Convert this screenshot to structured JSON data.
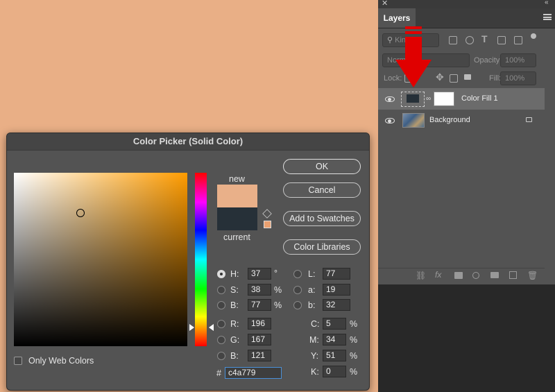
{
  "colors": {
    "new": "#e9b089",
    "current": "#263038",
    "accent_arrow": "#e00000"
  },
  "layers_panel": {
    "tab_label": "Layers",
    "filter_placeholder": "Kind",
    "blend_mode": "Normal",
    "opacity_label": "Opacity:",
    "opacity_value": "100%",
    "lock_label": "Lock:",
    "fill_label": "Fill:",
    "fill_value": "100%",
    "layers": [
      {
        "name": "Color Fill 1"
      },
      {
        "name": "Background"
      }
    ]
  },
  "dialog": {
    "title": "Color Picker (Solid Color)",
    "new_label": "new",
    "current_label": "current",
    "buttons": {
      "ok": "OK",
      "cancel": "Cancel",
      "add_swatches": "Add to Swatches",
      "color_libraries": "Color Libraries"
    },
    "only_web_colors": "Only Web Colors",
    "hsb": [
      {
        "label": "H:",
        "value": "37",
        "unit": "°"
      },
      {
        "label": "S:",
        "value": "38",
        "unit": "%"
      },
      {
        "label": "B:",
        "value": "77",
        "unit": "%"
      }
    ],
    "lab": [
      {
        "label": "L:",
        "value": "77"
      },
      {
        "label": "a:",
        "value": "19"
      },
      {
        "label": "b:",
        "value": "32"
      }
    ],
    "rgb": [
      {
        "label": "R:",
        "value": "196"
      },
      {
        "label": "G:",
        "value": "167"
      },
      {
        "label": "B:",
        "value": "121"
      }
    ],
    "cmyk": [
      {
        "label": "C:",
        "value": "5",
        "unit": "%"
      },
      {
        "label": "M:",
        "value": "34",
        "unit": "%"
      },
      {
        "label": "Y:",
        "value": "51",
        "unit": "%"
      },
      {
        "label": "K:",
        "value": "0",
        "unit": "%"
      }
    ],
    "hex_label": "#",
    "hex_value": "c4a779"
  }
}
